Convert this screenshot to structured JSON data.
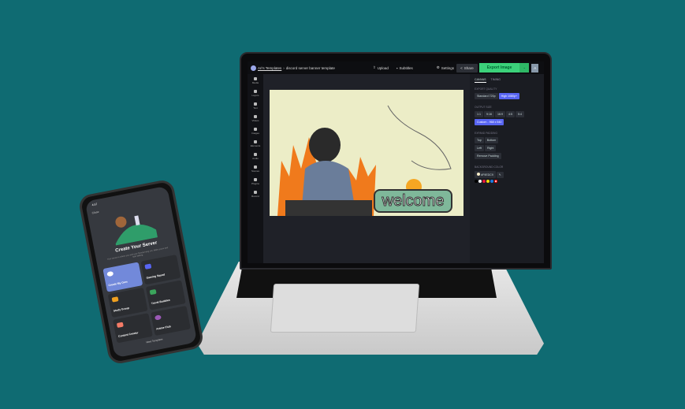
{
  "app": {
    "breadcrumb_root": "Ari's Templates",
    "breadcrumb_sep": "›",
    "document_title": "discord server banner template"
  },
  "toolbar": {
    "upload": "Upload",
    "subtitles": "Subtitles",
    "settings": "Settings",
    "share": "Share",
    "export": "Export Image",
    "avatar": "A"
  },
  "sidebar": {
    "items": [
      "Media",
      "Layers",
      "Text",
      "Videos",
      "Images",
      "Elements",
      "Audio",
      "Scenes",
      "Plugins",
      "Record"
    ]
  },
  "canvas": {
    "welcome_text": "welcome",
    "background_color": "#ecedc7"
  },
  "panel": {
    "tabs": [
      "CANVAS",
      "TIMING"
    ],
    "export_quality_label": "EXPORT QUALITY",
    "quality_options": [
      "Standard 720p",
      "High 1080p+"
    ],
    "quality_selected": "High 1080p+",
    "output_size_label": "OUTPUT SIZE",
    "sizes": [
      "1:1",
      "9:16",
      "16:9",
      "4:5",
      "5:4"
    ],
    "custom_size": "Custom - 968 x 540",
    "expand_padding_label": "EXPAND PADDING",
    "padding": [
      "Top",
      "Bottom",
      "Left",
      "Right"
    ],
    "remove_padding": "Remove Padding",
    "bg_color_label": "BACKGROUND COLOR",
    "bg_color_value": "#F9EDC9",
    "swatches": [
      "#000000",
      "#ffffff",
      "#e8173b",
      "#f5d90a",
      "#1e7de0"
    ]
  },
  "phone": {
    "time": "4:57",
    "close": "Close",
    "title": "Create Your Server",
    "subtitle": "Your server is where you and your friends hang out. Make yours and start talking.",
    "tiles": [
      {
        "label": "Create My Own",
        "color": "#ffffff"
      },
      {
        "label": "Gaming Squad",
        "color": "#5865f2"
      },
      {
        "label": "Study Group",
        "color": "#f0a020"
      },
      {
        "label": "Travel Buddies",
        "color": "#3ba55c"
      },
      {
        "label": "Content Creator",
        "color": "#f47b67"
      },
      {
        "label": "Anime Club",
        "color": "#9b59b6"
      }
    ],
    "more": "More Templates"
  },
  "colors": {
    "background": "#0f6b72",
    "accent": "#5865f2",
    "export": "#3bd27a"
  }
}
